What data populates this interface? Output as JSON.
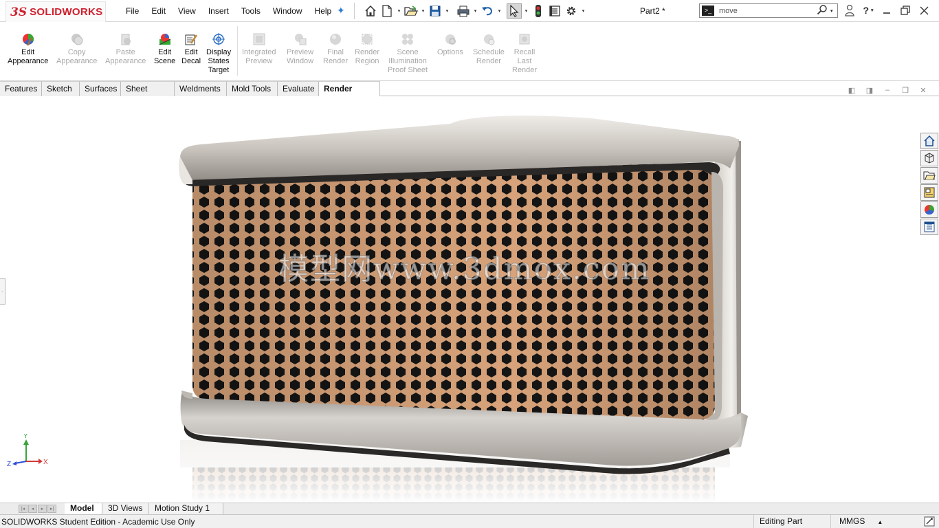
{
  "app": {
    "logo_ds": "3S",
    "logo_text": "SOLIDWORKS",
    "document_title": "Part2 *"
  },
  "menu": [
    "File",
    "Edit",
    "View",
    "Insert",
    "Tools",
    "Window",
    "Help"
  ],
  "search": {
    "value": "move",
    "placeholder": "move"
  },
  "quick_access_icons": [
    "home-icon",
    "new-document-icon",
    "open-icon",
    "save-icon",
    "print-icon",
    "undo-icon",
    "select-icon",
    "rebuild-icon",
    "file-properties-icon",
    "options-icon"
  ],
  "render_tools": [
    {
      "label": "Edit Appearance",
      "lines": [
        "Edit",
        "Appearance"
      ],
      "enabled": true,
      "icon": "edit-appearance-icon"
    },
    {
      "label": "Copy Appearance",
      "lines": [
        "Copy",
        "Appearance"
      ],
      "enabled": false,
      "icon": "copy-appearance-icon"
    },
    {
      "label": "Paste Appearance",
      "lines": [
        "Paste",
        "Appearance"
      ],
      "enabled": false,
      "icon": "paste-appearance-icon"
    },
    {
      "label": "Edit Scene",
      "lines": [
        "Edit",
        "Scene"
      ],
      "enabled": true,
      "icon": "edit-scene-icon"
    },
    {
      "label": "Edit Decal",
      "lines": [
        "Edit",
        "Decal"
      ],
      "enabled": true,
      "icon": "edit-decal-icon"
    },
    {
      "label": "Display States Target",
      "lines": [
        "Display",
        "States",
        "Target"
      ],
      "enabled": true,
      "icon": "display-states-target-icon"
    },
    {
      "label": "Integrated Preview",
      "lines": [
        "Integrated",
        "Preview"
      ],
      "enabled": false,
      "icon": "integrated-preview-icon"
    },
    {
      "label": "Preview Window",
      "lines": [
        "Preview",
        "Window"
      ],
      "enabled": false,
      "icon": "preview-window-icon"
    },
    {
      "label": "Final Render",
      "lines": [
        "Final",
        "Render"
      ],
      "enabled": false,
      "icon": "final-render-icon"
    },
    {
      "label": "Render Region",
      "lines": [
        "Render",
        "Region"
      ],
      "enabled": false,
      "icon": "render-region-icon"
    },
    {
      "label": "Scene Illumination Proof Sheet",
      "lines": [
        "Scene",
        "Illumination",
        "Proof Sheet"
      ],
      "enabled": false,
      "icon": "scene-illumination-icon"
    },
    {
      "label": "Options",
      "lines": [
        "Options"
      ],
      "enabled": false,
      "icon": "options-render-icon"
    },
    {
      "label": "Schedule Render",
      "lines": [
        "Schedule",
        "Render"
      ],
      "enabled": false,
      "icon": "schedule-render-icon"
    },
    {
      "label": "Recall Last Render",
      "lines": [
        "Recall",
        "Last",
        "Render"
      ],
      "enabled": false,
      "icon": "recall-last-render-icon"
    }
  ],
  "command_tabs": [
    "Features",
    "Sketch",
    "Surfaces",
    "Sheet Metal",
    "Weldments",
    "Mold Tools",
    "Evaluate",
    "Render Tools"
  ],
  "active_command_tab": "Render Tools",
  "viewport": {
    "watermark": "模型网www.3dmox.com"
  },
  "triad": {
    "x": "X",
    "y": "Y",
    "z": "Z"
  },
  "task_pane_icons": [
    "solidworks-resources-icon",
    "design-library-icon",
    "file-explorer-icon",
    "view-palette-icon",
    "appearances-scenes-icon",
    "custom-properties-icon"
  ],
  "bottom_tabs": [
    "Model",
    "3D Views",
    "Motion Study 1"
  ],
  "active_bottom_tab": "Model",
  "status": {
    "edition": "SOLIDWORKS Student Edition - Academic Use Only",
    "mode": "Editing Part",
    "units": "MMGS"
  },
  "colors": {
    "brand": "#d0202e",
    "mesh": "#d9a47a",
    "frame": "#c9c4bd",
    "accent": "#2c7bd3"
  }
}
